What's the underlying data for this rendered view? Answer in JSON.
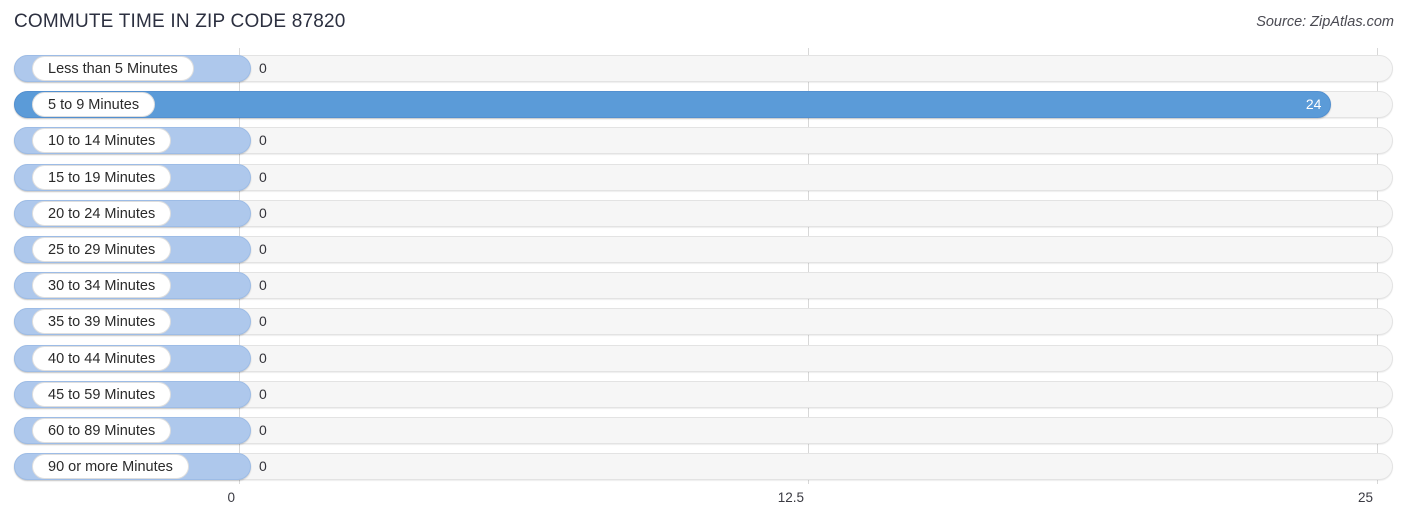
{
  "header": {
    "title": "COMMUTE TIME IN ZIP CODE 87820",
    "source": "Source: ZipAtlas.com"
  },
  "colors": {
    "bar_zero": "#aec8ec",
    "bar_highlight": "#5b9bd8",
    "track": "#f6f6f6",
    "title": "#2c3040",
    "gridline": "#d8d8d8"
  },
  "chart_data": {
    "type": "bar",
    "orientation": "horizontal",
    "title": "COMMUTE TIME IN ZIP CODE 87820",
    "xlabel": "",
    "ylabel": "",
    "xlim": [
      0,
      25
    ],
    "grid": true,
    "legend": "none",
    "tick_labels": [
      "0",
      "12.5",
      "25"
    ],
    "ticks": [
      0,
      12.5,
      25
    ],
    "categories": [
      "Less than 5 Minutes",
      "5 to 9 Minutes",
      "10 to 14 Minutes",
      "15 to 19 Minutes",
      "20 to 24 Minutes",
      "25 to 29 Minutes",
      "30 to 34 Minutes",
      "35 to 39 Minutes",
      "40 to 44 Minutes",
      "45 to 59 Minutes",
      "60 to 89 Minutes",
      "90 or more Minutes"
    ],
    "values": [
      0,
      24,
      0,
      0,
      0,
      0,
      0,
      0,
      0,
      0,
      0,
      0
    ],
    "value_labels": [
      "0",
      "24",
      "0",
      "0",
      "0",
      "0",
      "0",
      "0",
      "0",
      "0",
      "0",
      "0"
    ]
  }
}
